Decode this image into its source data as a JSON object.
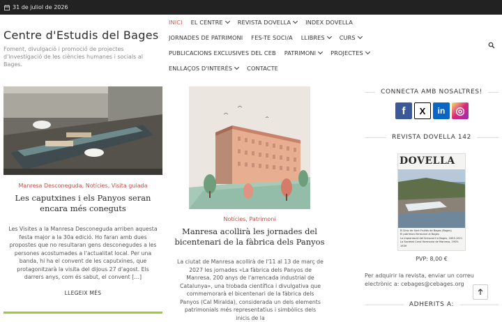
{
  "topbar": {
    "date": "31 de juliol de 2026"
  },
  "site": {
    "title": "Centre d'Estudis del Bages",
    "description": "Foment, divulgació i promoció de projectes d'investigació de les ciències humanes i socials al Bages."
  },
  "nav": {
    "row1": [
      {
        "label": "INICI",
        "dropdown": false,
        "active": true
      },
      {
        "label": "EL CENTRE",
        "dropdown": true
      },
      {
        "label": "REVISTA DOVELLA",
        "dropdown": true
      },
      {
        "label": "INDEX DOVELLA",
        "dropdown": false
      }
    ],
    "row2": [
      {
        "label": "JORNADES DE PATRIMONI",
        "dropdown": false
      },
      {
        "label": "FES-TE SOCI/A",
        "dropdown": false
      },
      {
        "label": "LLIBRES",
        "dropdown": true
      },
      {
        "label": "CURS",
        "dropdown": true
      }
    ],
    "row3": [
      {
        "label": "PUBLICACIONS EXCLUSIVES DEL CEB",
        "dropdown": false
      },
      {
        "label": "PATRIMONI",
        "dropdown": true
      },
      {
        "label": "PROJECTES",
        "dropdown": true
      }
    ],
    "row4": [
      {
        "label": "ENLLAÇOS D'INTERÈS",
        "dropdown": true
      },
      {
        "label": "CONTACTE",
        "dropdown": false
      }
    ]
  },
  "post1": {
    "categories": "Manresa Desconeguda, Notícies, Visita guiada",
    "title": "Les caputxines i els Panyos seran encara més coneguts",
    "excerpt": "Les Visites a la Manresa Desconeguda arriben aquesta festa major a la 30a edició. Ho faran amb dues propostes que no resultaran gens desconegudes a les persones acostumades a l'actualitat local. Per una banda, hi ha el convent de les caputxines, que protagonitzarà la visita del dijous 27 d'agost. Els darrers anys, com és sabut, el convent […]",
    "readmore": "LLEGEIX MÉS"
  },
  "post2": {
    "categories": "Notícies, Patrimoni",
    "title": "Manresa acollirà les jornades del bicentenari de la fàbrica dels Panyos",
    "excerpt": "La ciutat de Manresa acollirà de l'11 al 13 de març de 2027 les jornades «La fàbrica dels Panyos de Manresa. 200 anys de l'arrencada industrial de Catalunya», una trobada científica i divulgativa que commemorarà el bicentenari de la fàbrica dels Panyos (Cal Miralda), considerada un dels elements patrimonials més representatius i simbòlics dels inicis de la"
  },
  "sidebar": {
    "connect_title": "CONNECTA AMB NOSALTRES!",
    "social": [
      {
        "name": "facebook",
        "glyph": "f",
        "color": "#3b5998"
      },
      {
        "name": "x",
        "glyph": "X",
        "color": "#000000"
      },
      {
        "name": "linkedin",
        "glyph": "in",
        "color": "#0a66c2"
      },
      {
        "name": "instagram",
        "glyph": "◎",
        "color": "#d6249f"
      }
    ],
    "revista_title": "REVISTA DOVELLA 142",
    "magazine": {
      "masthead": "DOVELLA",
      "lines": [
        "El Drac de Sant Fruitós de Bages (Bages)",
        "El patrimoni ferroviari al Bages",
        "La implantació del ferrocarril a Bages, 1853-1921",
        "La Societat Coral Harmonia de Manresa, 1909-1939"
      ]
    },
    "price": "PVP: 8,00 €",
    "order_text": "Per adquirir la revista, enviar un correu electrònic a: cebages@cebages.org",
    "adherits_title": "ADHERITS A:"
  }
}
